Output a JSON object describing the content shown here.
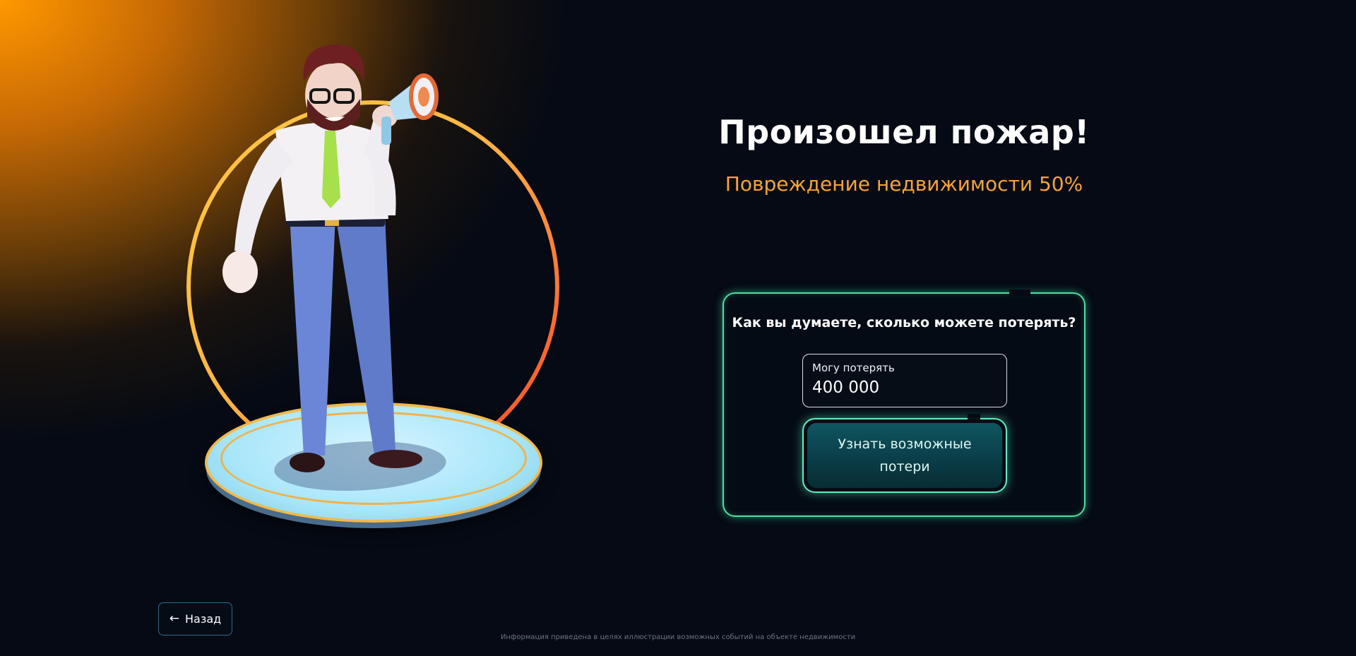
{
  "header": {
    "title": "Произошел пожар!",
    "subtitle": "Повреждение недвижимости 50%"
  },
  "card": {
    "question": "Как вы думаете, сколько можете потерять?",
    "field_label": "Могу потерять",
    "field_value": "400 000",
    "cta_label": "Узнать возможные потери"
  },
  "nav": {
    "back_label": "Назад",
    "back_icon": "arrow-left-icon"
  },
  "footer": {
    "note": "Информация приведена в целях иллюстрации возможных событий на объекте недвижимости"
  },
  "colors": {
    "accent_orange": "#f7a437",
    "accent_green": "#4fe0a0",
    "background": "#050a14"
  }
}
